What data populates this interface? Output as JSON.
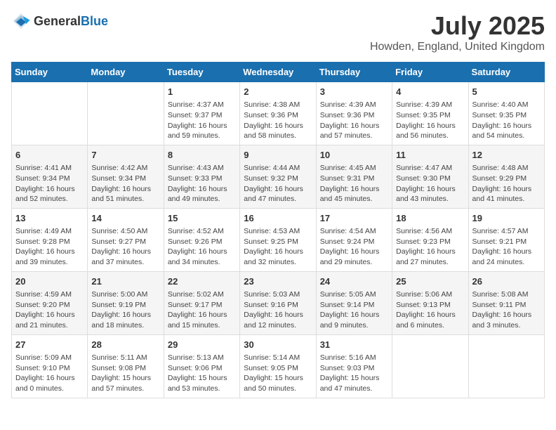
{
  "header": {
    "logo_general": "General",
    "logo_blue": "Blue",
    "month": "July 2025",
    "location": "Howden, England, United Kingdom"
  },
  "weekdays": [
    "Sunday",
    "Monday",
    "Tuesday",
    "Wednesday",
    "Thursday",
    "Friday",
    "Saturday"
  ],
  "weeks": [
    [
      {
        "day": "",
        "info": ""
      },
      {
        "day": "",
        "info": ""
      },
      {
        "day": "1",
        "info": "Sunrise: 4:37 AM\nSunset: 9:37 PM\nDaylight: 16 hours\nand 59 minutes."
      },
      {
        "day": "2",
        "info": "Sunrise: 4:38 AM\nSunset: 9:36 PM\nDaylight: 16 hours\nand 58 minutes."
      },
      {
        "day": "3",
        "info": "Sunrise: 4:39 AM\nSunset: 9:36 PM\nDaylight: 16 hours\nand 57 minutes."
      },
      {
        "day": "4",
        "info": "Sunrise: 4:39 AM\nSunset: 9:35 PM\nDaylight: 16 hours\nand 56 minutes."
      },
      {
        "day": "5",
        "info": "Sunrise: 4:40 AM\nSunset: 9:35 PM\nDaylight: 16 hours\nand 54 minutes."
      }
    ],
    [
      {
        "day": "6",
        "info": "Sunrise: 4:41 AM\nSunset: 9:34 PM\nDaylight: 16 hours\nand 52 minutes."
      },
      {
        "day": "7",
        "info": "Sunrise: 4:42 AM\nSunset: 9:34 PM\nDaylight: 16 hours\nand 51 minutes."
      },
      {
        "day": "8",
        "info": "Sunrise: 4:43 AM\nSunset: 9:33 PM\nDaylight: 16 hours\nand 49 minutes."
      },
      {
        "day": "9",
        "info": "Sunrise: 4:44 AM\nSunset: 9:32 PM\nDaylight: 16 hours\nand 47 minutes."
      },
      {
        "day": "10",
        "info": "Sunrise: 4:45 AM\nSunset: 9:31 PM\nDaylight: 16 hours\nand 45 minutes."
      },
      {
        "day": "11",
        "info": "Sunrise: 4:47 AM\nSunset: 9:30 PM\nDaylight: 16 hours\nand 43 minutes."
      },
      {
        "day": "12",
        "info": "Sunrise: 4:48 AM\nSunset: 9:29 PM\nDaylight: 16 hours\nand 41 minutes."
      }
    ],
    [
      {
        "day": "13",
        "info": "Sunrise: 4:49 AM\nSunset: 9:28 PM\nDaylight: 16 hours\nand 39 minutes."
      },
      {
        "day": "14",
        "info": "Sunrise: 4:50 AM\nSunset: 9:27 PM\nDaylight: 16 hours\nand 37 minutes."
      },
      {
        "day": "15",
        "info": "Sunrise: 4:52 AM\nSunset: 9:26 PM\nDaylight: 16 hours\nand 34 minutes."
      },
      {
        "day": "16",
        "info": "Sunrise: 4:53 AM\nSunset: 9:25 PM\nDaylight: 16 hours\nand 32 minutes."
      },
      {
        "day": "17",
        "info": "Sunrise: 4:54 AM\nSunset: 9:24 PM\nDaylight: 16 hours\nand 29 minutes."
      },
      {
        "day": "18",
        "info": "Sunrise: 4:56 AM\nSunset: 9:23 PM\nDaylight: 16 hours\nand 27 minutes."
      },
      {
        "day": "19",
        "info": "Sunrise: 4:57 AM\nSunset: 9:21 PM\nDaylight: 16 hours\nand 24 minutes."
      }
    ],
    [
      {
        "day": "20",
        "info": "Sunrise: 4:59 AM\nSunset: 9:20 PM\nDaylight: 16 hours\nand 21 minutes."
      },
      {
        "day": "21",
        "info": "Sunrise: 5:00 AM\nSunset: 9:19 PM\nDaylight: 16 hours\nand 18 minutes."
      },
      {
        "day": "22",
        "info": "Sunrise: 5:02 AM\nSunset: 9:17 PM\nDaylight: 16 hours\nand 15 minutes."
      },
      {
        "day": "23",
        "info": "Sunrise: 5:03 AM\nSunset: 9:16 PM\nDaylight: 16 hours\nand 12 minutes."
      },
      {
        "day": "24",
        "info": "Sunrise: 5:05 AM\nSunset: 9:14 PM\nDaylight: 16 hours\nand 9 minutes."
      },
      {
        "day": "25",
        "info": "Sunrise: 5:06 AM\nSunset: 9:13 PM\nDaylight: 16 hours\nand 6 minutes."
      },
      {
        "day": "26",
        "info": "Sunrise: 5:08 AM\nSunset: 9:11 PM\nDaylight: 16 hours\nand 3 minutes."
      }
    ],
    [
      {
        "day": "27",
        "info": "Sunrise: 5:09 AM\nSunset: 9:10 PM\nDaylight: 16 hours\nand 0 minutes."
      },
      {
        "day": "28",
        "info": "Sunrise: 5:11 AM\nSunset: 9:08 PM\nDaylight: 15 hours\nand 57 minutes."
      },
      {
        "day": "29",
        "info": "Sunrise: 5:13 AM\nSunset: 9:06 PM\nDaylight: 15 hours\nand 53 minutes."
      },
      {
        "day": "30",
        "info": "Sunrise: 5:14 AM\nSunset: 9:05 PM\nDaylight: 15 hours\nand 50 minutes."
      },
      {
        "day": "31",
        "info": "Sunrise: 5:16 AM\nSunset: 9:03 PM\nDaylight: 15 hours\nand 47 minutes."
      },
      {
        "day": "",
        "info": ""
      },
      {
        "day": "",
        "info": ""
      }
    ]
  ]
}
